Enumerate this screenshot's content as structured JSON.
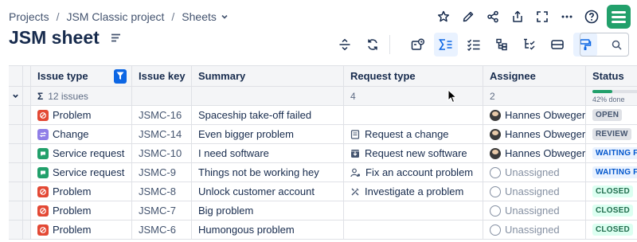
{
  "breadcrumb": {
    "items": [
      "Projects",
      "JSM Classic project",
      "Sheets"
    ],
    "separator": "/"
  },
  "page": {
    "title": "JSM sheet"
  },
  "top_icons": [
    "star-icon",
    "edit-pencil-icon",
    "share-icon",
    "export-icon",
    "fullscreen-icon",
    "more-icon",
    "help-icon",
    "app-logo"
  ],
  "toolbar": {
    "icons": [
      "row-height-icon",
      "refresh-icon",
      "add-filter-icon",
      "sum-icon",
      "checklist-icon",
      "tree-icon",
      "tree-check-icon",
      "card-icon",
      "paint-format-icon"
    ],
    "active": [
      "sum-icon",
      "paint-format-icon"
    ]
  },
  "search": {
    "placeholder": ""
  },
  "table": {
    "columns": [
      "Issue type",
      "Issue key",
      "Summary",
      "Request type",
      "Assignee",
      "Status"
    ],
    "group": {
      "count_label": "12 issues",
      "request_type_count": "4",
      "assignee_count": "2",
      "status_progress_label": "42% done",
      "status_progress": 0.42
    },
    "rows": [
      {
        "type": "Problem",
        "type_color": "#e34935",
        "key": "JSMC-16",
        "summary": "Spaceship take-off failed",
        "request": "",
        "request_icon": "",
        "assignee": "Hannes Obweger",
        "assigned": true,
        "status": "OPEN",
        "status_bg": "#dfe1e6",
        "status_fg": "#44546f"
      },
      {
        "type": "Change",
        "type_color": "#8f7ee7",
        "key": "JSMC-14",
        "summary": "Even bigger problem",
        "request": "Request a change",
        "request_icon": "doc-icon",
        "assignee": "Hannes Obweger",
        "assigned": true,
        "status": "REVIEW",
        "status_bg": "#dfe1e6",
        "status_fg": "#44546f"
      },
      {
        "type": "Service request",
        "type_color": "#22a06b",
        "key": "JSMC-10",
        "summary": "I need software",
        "request": "Request new software",
        "request_icon": "download-box-icon",
        "assignee": "Hannes Obweger",
        "assigned": true,
        "status": "WAITING FOR",
        "status_bg": "#e9f2ff",
        "status_fg": "#0055cc"
      },
      {
        "type": "Service request",
        "type_color": "#22a06b",
        "key": "JSMC-9",
        "summary": "Things not be working hey",
        "request": "Fix an account problem",
        "request_icon": "user-gear-icon",
        "assignee": "Unassigned",
        "assigned": false,
        "status": "WAITING FOR",
        "status_bg": "#e9f2ff",
        "status_fg": "#0055cc"
      },
      {
        "type": "Problem",
        "type_color": "#e34935",
        "key": "JSMC-8",
        "summary": "Unlock customer account",
        "request": "Investigate a problem",
        "request_icon": "tools-icon",
        "assignee": "Unassigned",
        "assigned": false,
        "status": "CLOSED",
        "status_bg": "#dcfff1",
        "status_fg": "#216e4e"
      },
      {
        "type": "Problem",
        "type_color": "#e34935",
        "key": "JSMC-7",
        "summary": "Big problem",
        "request": "",
        "request_icon": "",
        "assignee": "Unassigned",
        "assigned": false,
        "status": "CLOSED",
        "status_bg": "#dcfff1",
        "status_fg": "#216e4e"
      },
      {
        "type": "Problem",
        "type_color": "#e34935",
        "key": "JSMC-6",
        "summary": "Humongous problem",
        "request": "",
        "request_icon": "",
        "assignee": "Unassigned",
        "assigned": false,
        "status": "CLOSED",
        "status_bg": "#dcfff1",
        "status_fg": "#216e4e"
      }
    ]
  }
}
